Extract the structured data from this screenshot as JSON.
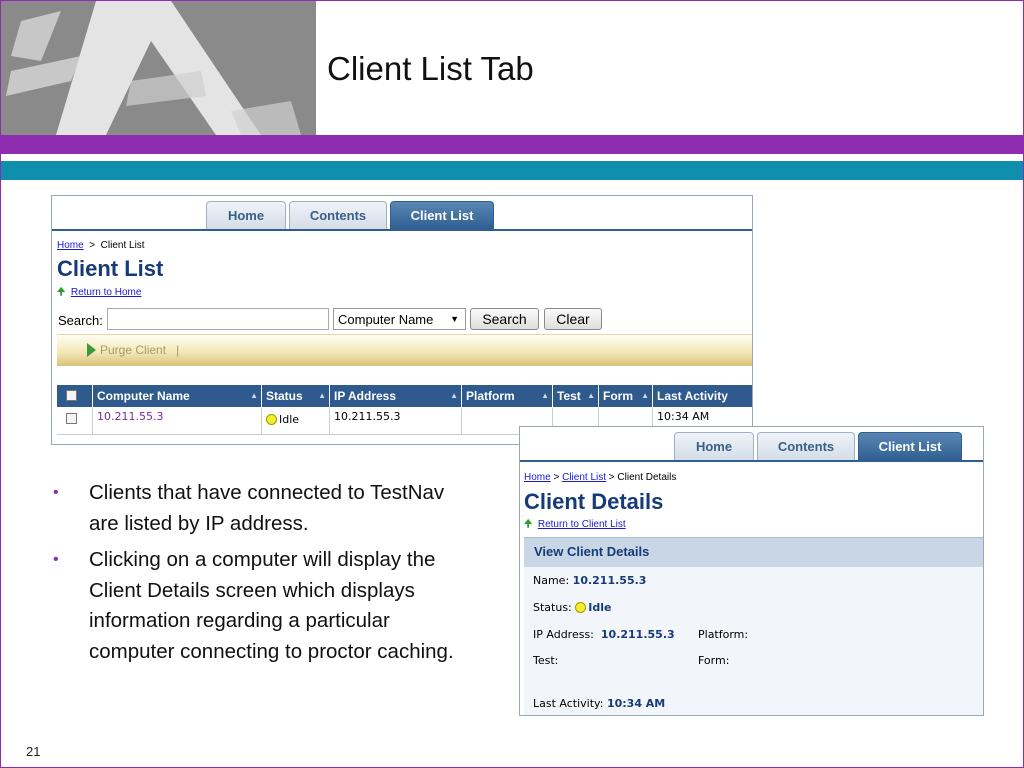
{
  "slide": {
    "title": "Client List Tab",
    "number": "21",
    "colors": {
      "purple": "#8e2db0",
      "teal": "#0f8fac",
      "nav_blue": "#2e5a8e"
    }
  },
  "client_list_screen": {
    "tabs": [
      "Home",
      "Contents",
      "Client List"
    ],
    "active_tab": "Client List",
    "breadcrumb": {
      "home": "Home",
      "separator": ">",
      "current": "Client List"
    },
    "heading": "Client List",
    "return_link": "Return to Home",
    "search_label": "Search:",
    "search_value": "",
    "search_field_select": "Computer Name",
    "search_button": "Search",
    "clear_button": "Clear",
    "toolbar": {
      "purge": "Purge Client",
      "separator": "|"
    },
    "table": {
      "columns": [
        "Computer Name",
        "Status",
        "IP Address",
        "Platform",
        "Test",
        "Form",
        "Last Activity"
      ],
      "rows": [
        {
          "computer_name": "10.211.55.3",
          "status": "Idle",
          "ip_address": "10.211.55.3",
          "platform": "",
          "test": "",
          "form": "",
          "last_activity": "10:34 AM"
        }
      ]
    }
  },
  "bullets": [
    "Clients that have connected to TestNav are listed by IP address.",
    "Clicking on a computer will display the Client Details screen which displays information regarding a particular computer connecting to proctor caching."
  ],
  "client_details_screen": {
    "tabs": [
      "Home",
      "Contents",
      "Client List"
    ],
    "active_tab": "Client List",
    "breadcrumb": {
      "home": "Home",
      "client_list": "Client List",
      "current": "Client Details",
      "separator": ">"
    },
    "heading": "Client Details",
    "return_link": "Return to Client List",
    "panel_title": "View Client Details",
    "fields": {
      "name_label": "Name:",
      "name_value": "10.211.55.3",
      "status_label": "Status:",
      "status_value": "Idle",
      "ip_label": "IP Address:",
      "ip_value": "10.211.55.3",
      "platform_label": "Platform:",
      "platform_value": "",
      "test_label": "Test:",
      "test_value": "",
      "form_label": "Form:",
      "form_value": "",
      "last_activity_label": "Last Activity:",
      "last_activity_value": "10:34 AM"
    }
  }
}
